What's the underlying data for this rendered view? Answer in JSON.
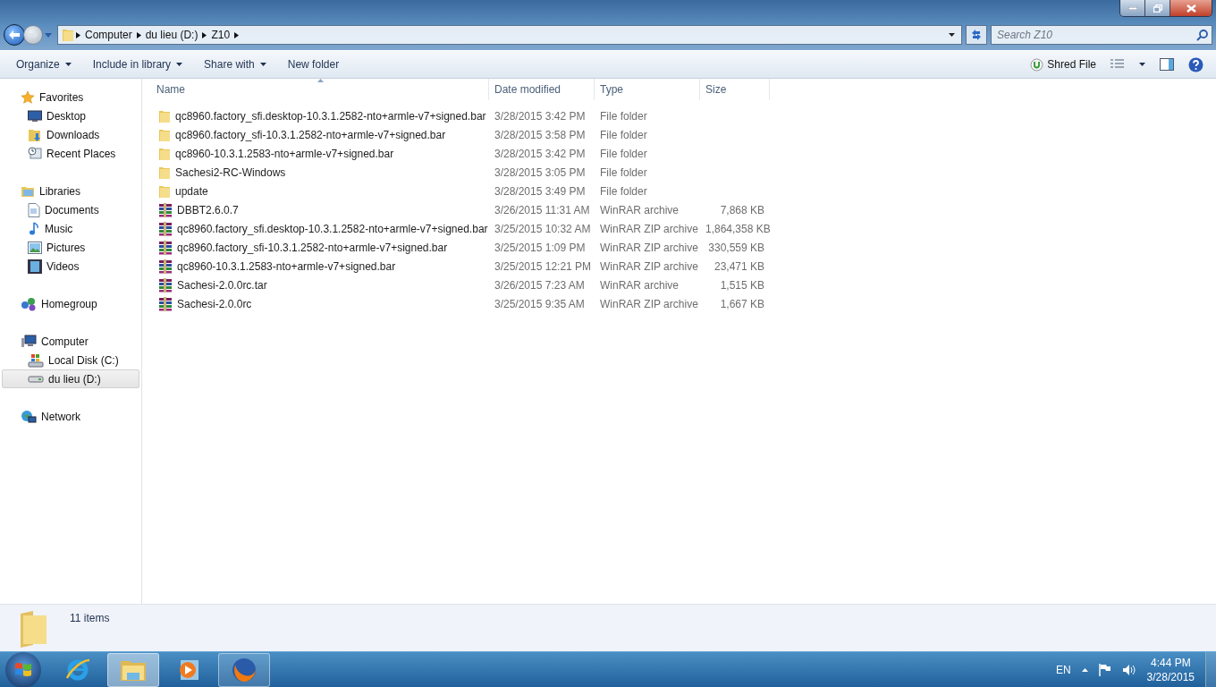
{
  "address_bar": {
    "breadcrumbs": [
      "Computer",
      "du lieu (D:)",
      "Z10"
    ]
  },
  "search": {
    "placeholder": "Search Z10"
  },
  "toolbar": {
    "items": [
      {
        "label": "Organize",
        "kind": "menu"
      },
      {
        "label": "Include in library",
        "kind": "menu"
      },
      {
        "label": "Share with",
        "kind": "menu"
      },
      {
        "label": "New folder",
        "kind": "button"
      }
    ],
    "shred": {
      "label": "Shred File"
    }
  },
  "sidebar": {
    "groups": [
      {
        "label": "Favorites",
        "kind": "favorites",
        "selected": false,
        "children": [
          {
            "label": "Desktop",
            "kind": "desktop",
            "selected": false
          },
          {
            "label": "Downloads",
            "kind": "downloads",
            "selected": false
          },
          {
            "label": "Recent Places",
            "kind": "recent",
            "selected": false
          }
        ]
      },
      {
        "label": "Libraries",
        "kind": "libraries",
        "selected": false,
        "children": [
          {
            "label": "Documents",
            "kind": "documents",
            "selected": false
          },
          {
            "label": "Music",
            "kind": "music",
            "selected": false
          },
          {
            "label": "Pictures",
            "kind": "pictures",
            "selected": false
          },
          {
            "label": "Videos",
            "kind": "videos",
            "selected": false
          }
        ]
      },
      {
        "label": "Homegroup",
        "kind": "homegroup",
        "selected": false
      },
      {
        "label": "Computer",
        "kind": "computer",
        "selected": false,
        "children": [
          {
            "label": "Local Disk (C:)",
            "kind": "system-disk",
            "selected": false
          },
          {
            "label": "du lieu (D:)",
            "kind": "drive",
            "selected": true
          }
        ]
      },
      {
        "label": "Network",
        "kind": "network",
        "selected": false
      }
    ]
  },
  "table": {
    "columns": [
      {
        "label": "Name",
        "sorted": true
      },
      {
        "label": "Date modified",
        "sorted": false
      },
      {
        "label": "Type",
        "sorted": false
      },
      {
        "label": "Size",
        "sorted": false
      }
    ],
    "rows": [
      {
        "kind": "folder",
        "name": "qc8960.factory_sfi.desktop-10.3.1.2582-nto+armle-v7+signed.bar",
        "date": "3/28/2015 3:42 PM",
        "type": "File folder"
      },
      {
        "kind": "folder",
        "name": "qc8960.factory_sfi-10.3.1.2582-nto+armle-v7+signed.bar",
        "date": "3/28/2015 3:58 PM",
        "type": "File folder"
      },
      {
        "kind": "folder",
        "name": "qc8960-10.3.1.2583-nto+armle-v7+signed.bar",
        "date": "3/28/2015 3:42 PM",
        "type": "File folder"
      },
      {
        "kind": "folder",
        "name": "Sachesi2-RC-Windows",
        "date": "3/28/2015 3:05 PM",
        "type": "File folder"
      },
      {
        "kind": "folder",
        "name": "update",
        "date": "3/28/2015 3:49 PM",
        "type": "File folder"
      },
      {
        "kind": "archive",
        "name": "DBBT2.6.0.7",
        "date": "3/26/2015 11:31 AM",
        "type": "WinRAR archive",
        "size": "7,868 KB"
      },
      {
        "kind": "archive",
        "name": "qc8960.factory_sfi.desktop-10.3.1.2582-nto+armle-v7+signed.bar",
        "date": "3/25/2015 10:32 AM",
        "type": "WinRAR ZIP archive",
        "size": "1,864,358 KB"
      },
      {
        "kind": "archive",
        "name": "qc8960.factory_sfi-10.3.1.2582-nto+armle-v7+signed.bar",
        "date": "3/25/2015 1:09 PM",
        "type": "WinRAR ZIP archive",
        "size": "330,559 KB"
      },
      {
        "kind": "archive",
        "name": "qc8960-10.3.1.2583-nto+armle-v7+signed.bar",
        "date": "3/25/2015 12:21 PM",
        "type": "WinRAR ZIP archive",
        "size": "23,471 KB"
      },
      {
        "kind": "archive",
        "name": "Sachesi-2.0.0rc.tar",
        "date": "3/26/2015 7:23 AM",
        "type": "WinRAR archive",
        "size": "1,515 KB"
      },
      {
        "kind": "archive",
        "name": "Sachesi-2.0.0rc",
        "date": "3/25/2015 9:35 AM",
        "type": "WinRAR ZIP archive",
        "size": "1,667 KB"
      }
    ]
  },
  "details_pane": {
    "item_count": "11 items"
  },
  "taskbar": {
    "apps": [
      {
        "kind": "ie",
        "open": false,
        "active": false
      },
      {
        "kind": "explorer",
        "open": true,
        "active": true
      },
      {
        "kind": "media",
        "open": false,
        "active": false
      },
      {
        "kind": "firefox",
        "open": true,
        "active": false
      }
    ],
    "language": "EN",
    "time": "4:44 PM",
    "date": "3/28/2015"
  }
}
